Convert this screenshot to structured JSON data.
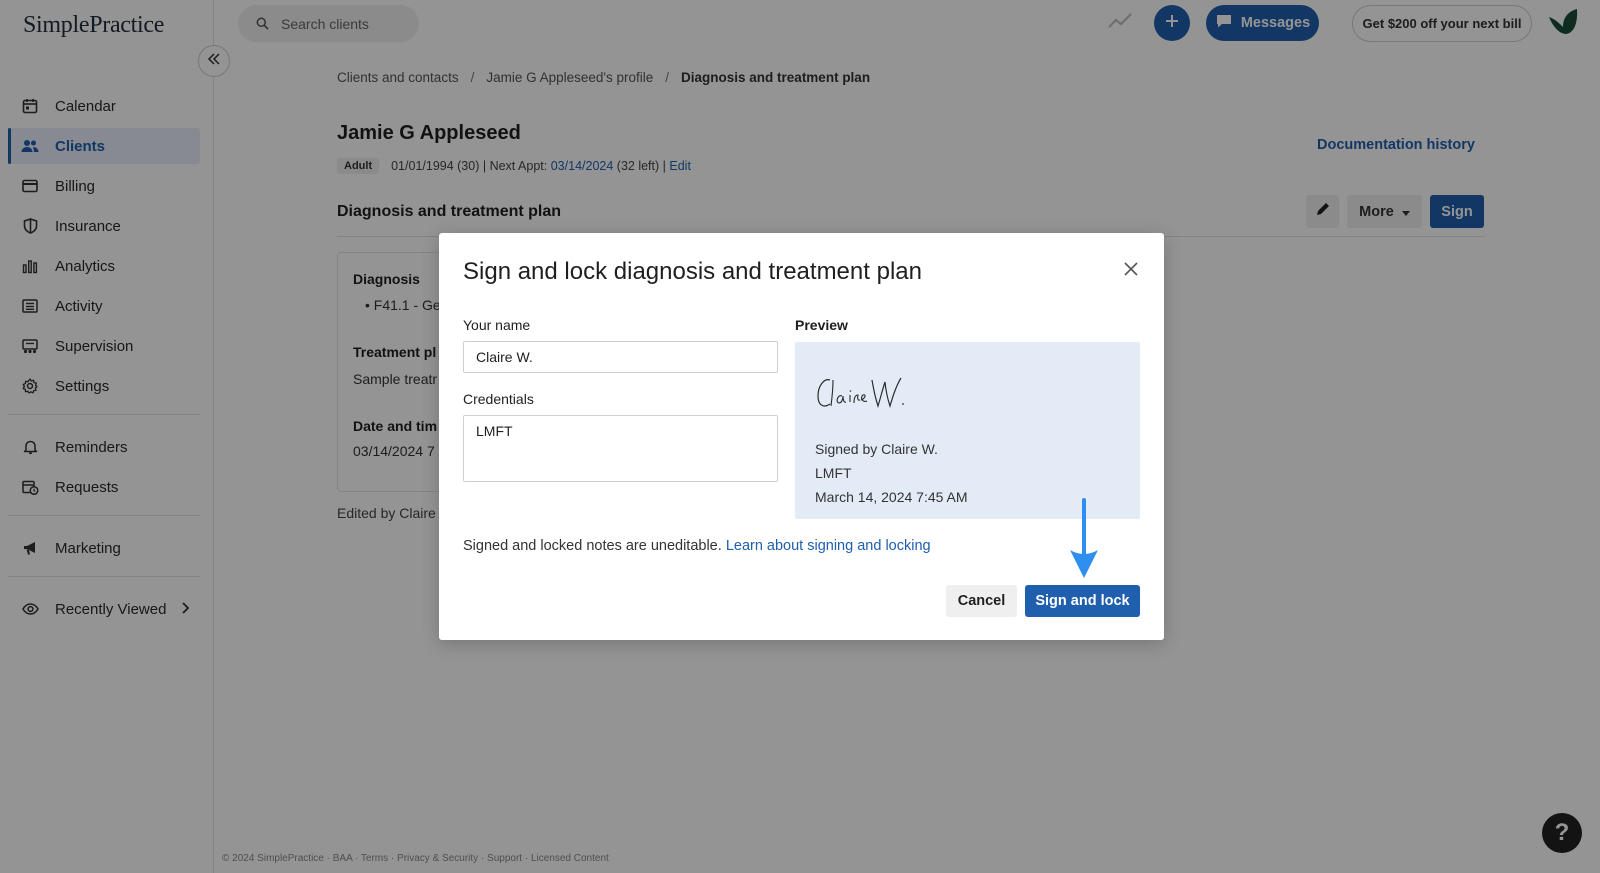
{
  "app": {
    "logo_text": "SimplePractice"
  },
  "sidebar": {
    "items": [
      {
        "label": "Calendar",
        "icon": "calendar-icon"
      },
      {
        "label": "Clients",
        "icon": "users-icon",
        "active": true
      },
      {
        "label": "Billing",
        "icon": "card-icon"
      },
      {
        "label": "Insurance",
        "icon": "shield-icon"
      },
      {
        "label": "Analytics",
        "icon": "bar-chart-icon"
      },
      {
        "label": "Activity",
        "icon": "list-icon"
      },
      {
        "label": "Supervision",
        "icon": "supervision-icon"
      },
      {
        "label": "Settings",
        "icon": "gear-icon"
      }
    ],
    "secondary": [
      {
        "label": "Reminders",
        "icon": "bell-icon"
      },
      {
        "label": "Requests",
        "icon": "calendar-clock-icon"
      }
    ],
    "marketing": {
      "label": "Marketing",
      "icon": "megaphone-icon"
    },
    "recently_viewed": {
      "label": "Recently Viewed",
      "icon": "eye-icon"
    }
  },
  "topbar": {
    "search_placeholder": "Search clients",
    "messages_label": "Messages",
    "promo_label": "Get $200 off your next bill"
  },
  "breadcrumb": {
    "items": [
      "Clients and contacts",
      "Jamie G Appleseed's profile"
    ],
    "current": "Diagnosis and treatment plan",
    "separator": "/"
  },
  "client": {
    "name": "Jamie G Appleseed",
    "badge": "Adult",
    "dob_age": "01/01/1994 (30) | Next Appt:",
    "next_appt": "03/14/2024",
    "remaining": "(32 left) |",
    "edit_label": "Edit"
  },
  "page": {
    "doc_history_label": "Documentation history",
    "section_title": "Diagnosis and treatment plan",
    "more_label": "More",
    "sign_label": "Sign",
    "diagnosis_label": "Diagnosis",
    "diagnosis_value": "F41.1 - Ge",
    "treatment_label": "Treatment pl",
    "treatment_value": "Sample treatr",
    "datetime_label": "Date and tim",
    "datetime_value": "03/14/2024 7",
    "edited_by": "Edited by Claire"
  },
  "footer": {
    "text": "© 2024 SimplePractice · BAA · Terms · Privacy & Security · Support · Licensed Content"
  },
  "help": {
    "label": "?"
  },
  "modal": {
    "title": "Sign and lock diagnosis and treatment plan",
    "name_label": "Your name",
    "name_value": "Claire W.",
    "credentials_label": "Credentials",
    "credentials_value": "LMFT",
    "preview_label": "Preview",
    "signature_text": "Claire W.",
    "signed_by": "Signed by Claire W.",
    "preview_credentials": "LMFT",
    "signed_date": "March 14, 2024 7:45 AM",
    "note": "Signed and locked notes are uneditable.",
    "note_link": "Learn about signing and locking",
    "cancel_label": "Cancel",
    "confirm_label": "Sign and lock"
  },
  "colors": {
    "accent": "#1f5fae",
    "arrow": "#2e8ff0",
    "preview_bg": "#e3ecf6"
  }
}
